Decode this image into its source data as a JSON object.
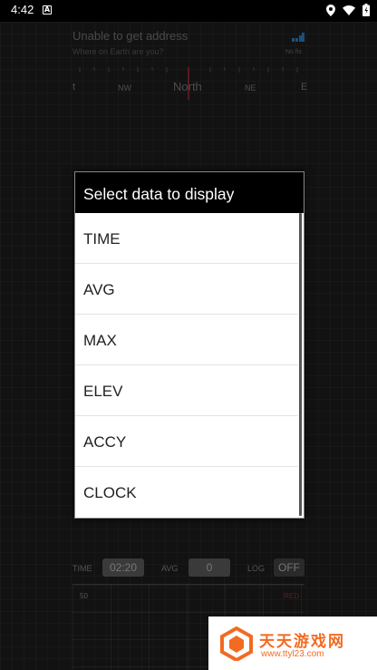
{
  "status_bar": {
    "time": "4:42",
    "notification_icon": "A"
  },
  "background": {
    "address_title": "Unable to get address",
    "address_subtitle": "Where on Earth are you?",
    "fix_status": "No fix",
    "compass_labels": [
      "t",
      "NW",
      "North",
      "NE",
      "E"
    ],
    "time_label": "TIME",
    "time_value": "02:20",
    "avg_label": "AVG",
    "avg_value": "0",
    "log_label": "LOG",
    "log_value": "OFF",
    "graph_y_label": "50",
    "graph_red_label": "RED"
  },
  "dialog": {
    "title": "Select data to display",
    "items": [
      "TIME",
      "AVG",
      "MAX",
      "ELEV",
      "ACCY",
      "CLOCK"
    ]
  },
  "watermark": {
    "text": "天天游戏网",
    "url": "www.ttyl23.com"
  },
  "colors": {
    "dialog_header": "#000000",
    "dialog_body": "#ffffff",
    "watermark_accent": "#f26b21"
  }
}
